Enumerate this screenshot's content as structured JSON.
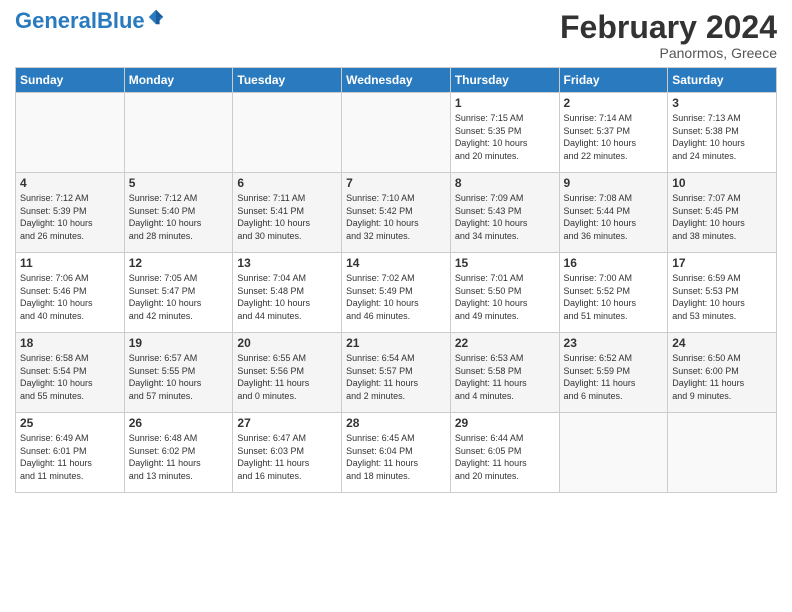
{
  "header": {
    "logo_general": "General",
    "logo_blue": "Blue",
    "month_title": "February 2024",
    "location": "Panormos, Greece"
  },
  "days_of_week": [
    "Sunday",
    "Monday",
    "Tuesday",
    "Wednesday",
    "Thursday",
    "Friday",
    "Saturday"
  ],
  "weeks": [
    {
      "shade": "white",
      "days": [
        {
          "num": "",
          "info": ""
        },
        {
          "num": "",
          "info": ""
        },
        {
          "num": "",
          "info": ""
        },
        {
          "num": "",
          "info": ""
        },
        {
          "num": "1",
          "info": "Sunrise: 7:15 AM\nSunset: 5:35 PM\nDaylight: 10 hours\nand 20 minutes."
        },
        {
          "num": "2",
          "info": "Sunrise: 7:14 AM\nSunset: 5:37 PM\nDaylight: 10 hours\nand 22 minutes."
        },
        {
          "num": "3",
          "info": "Sunrise: 7:13 AM\nSunset: 5:38 PM\nDaylight: 10 hours\nand 24 minutes."
        }
      ]
    },
    {
      "shade": "shade",
      "days": [
        {
          "num": "4",
          "info": "Sunrise: 7:12 AM\nSunset: 5:39 PM\nDaylight: 10 hours\nand 26 minutes."
        },
        {
          "num": "5",
          "info": "Sunrise: 7:12 AM\nSunset: 5:40 PM\nDaylight: 10 hours\nand 28 minutes."
        },
        {
          "num": "6",
          "info": "Sunrise: 7:11 AM\nSunset: 5:41 PM\nDaylight: 10 hours\nand 30 minutes."
        },
        {
          "num": "7",
          "info": "Sunrise: 7:10 AM\nSunset: 5:42 PM\nDaylight: 10 hours\nand 32 minutes."
        },
        {
          "num": "8",
          "info": "Sunrise: 7:09 AM\nSunset: 5:43 PM\nDaylight: 10 hours\nand 34 minutes."
        },
        {
          "num": "9",
          "info": "Sunrise: 7:08 AM\nSunset: 5:44 PM\nDaylight: 10 hours\nand 36 minutes."
        },
        {
          "num": "10",
          "info": "Sunrise: 7:07 AM\nSunset: 5:45 PM\nDaylight: 10 hours\nand 38 minutes."
        }
      ]
    },
    {
      "shade": "white",
      "days": [
        {
          "num": "11",
          "info": "Sunrise: 7:06 AM\nSunset: 5:46 PM\nDaylight: 10 hours\nand 40 minutes."
        },
        {
          "num": "12",
          "info": "Sunrise: 7:05 AM\nSunset: 5:47 PM\nDaylight: 10 hours\nand 42 minutes."
        },
        {
          "num": "13",
          "info": "Sunrise: 7:04 AM\nSunset: 5:48 PM\nDaylight: 10 hours\nand 44 minutes."
        },
        {
          "num": "14",
          "info": "Sunrise: 7:02 AM\nSunset: 5:49 PM\nDaylight: 10 hours\nand 46 minutes."
        },
        {
          "num": "15",
          "info": "Sunrise: 7:01 AM\nSunset: 5:50 PM\nDaylight: 10 hours\nand 49 minutes."
        },
        {
          "num": "16",
          "info": "Sunrise: 7:00 AM\nSunset: 5:52 PM\nDaylight: 10 hours\nand 51 minutes."
        },
        {
          "num": "17",
          "info": "Sunrise: 6:59 AM\nSunset: 5:53 PM\nDaylight: 10 hours\nand 53 minutes."
        }
      ]
    },
    {
      "shade": "shade",
      "days": [
        {
          "num": "18",
          "info": "Sunrise: 6:58 AM\nSunset: 5:54 PM\nDaylight: 10 hours\nand 55 minutes."
        },
        {
          "num": "19",
          "info": "Sunrise: 6:57 AM\nSunset: 5:55 PM\nDaylight: 10 hours\nand 57 minutes."
        },
        {
          "num": "20",
          "info": "Sunrise: 6:55 AM\nSunset: 5:56 PM\nDaylight: 11 hours\nand 0 minutes."
        },
        {
          "num": "21",
          "info": "Sunrise: 6:54 AM\nSunset: 5:57 PM\nDaylight: 11 hours\nand 2 minutes."
        },
        {
          "num": "22",
          "info": "Sunrise: 6:53 AM\nSunset: 5:58 PM\nDaylight: 11 hours\nand 4 minutes."
        },
        {
          "num": "23",
          "info": "Sunrise: 6:52 AM\nSunset: 5:59 PM\nDaylight: 11 hours\nand 6 minutes."
        },
        {
          "num": "24",
          "info": "Sunrise: 6:50 AM\nSunset: 6:00 PM\nDaylight: 11 hours\nand 9 minutes."
        }
      ]
    },
    {
      "shade": "white",
      "days": [
        {
          "num": "25",
          "info": "Sunrise: 6:49 AM\nSunset: 6:01 PM\nDaylight: 11 hours\nand 11 minutes."
        },
        {
          "num": "26",
          "info": "Sunrise: 6:48 AM\nSunset: 6:02 PM\nDaylight: 11 hours\nand 13 minutes."
        },
        {
          "num": "27",
          "info": "Sunrise: 6:47 AM\nSunset: 6:03 PM\nDaylight: 11 hours\nand 16 minutes."
        },
        {
          "num": "28",
          "info": "Sunrise: 6:45 AM\nSunset: 6:04 PM\nDaylight: 11 hours\nand 18 minutes."
        },
        {
          "num": "29",
          "info": "Sunrise: 6:44 AM\nSunset: 6:05 PM\nDaylight: 11 hours\nand 20 minutes."
        },
        {
          "num": "",
          "info": ""
        },
        {
          "num": "",
          "info": ""
        }
      ]
    }
  ]
}
